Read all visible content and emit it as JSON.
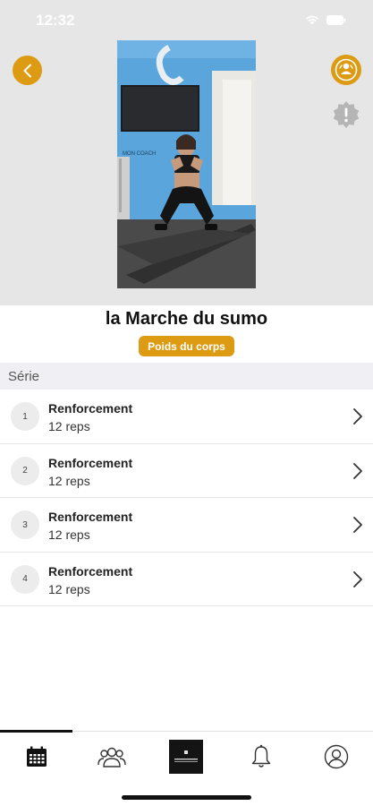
{
  "status_bar": {
    "time": "12:32"
  },
  "exercise": {
    "title": "la Marche du sumo",
    "badge": "Poids du corps",
    "video_wall_text": "MON COACH"
  },
  "section": {
    "header": "Série"
  },
  "series": [
    {
      "number": "1",
      "title": "Renforcement",
      "reps": "12 reps"
    },
    {
      "number": "2",
      "title": "Renforcement",
      "reps": "12 reps"
    },
    {
      "number": "3",
      "title": "Renforcement",
      "reps": "12 reps"
    },
    {
      "number": "4",
      "title": "Renforcement",
      "reps": "12 reps"
    }
  ],
  "tabbar": {
    "active_tab": "calendar",
    "tabs": [
      "calendar-icon",
      "group-icon",
      "app-logo-icon",
      "bell-icon",
      "profile-icon"
    ]
  },
  "colors": {
    "accent": "#dc9b12",
    "hero_background": "#e6e6e6",
    "section_background": "#efeff4"
  }
}
